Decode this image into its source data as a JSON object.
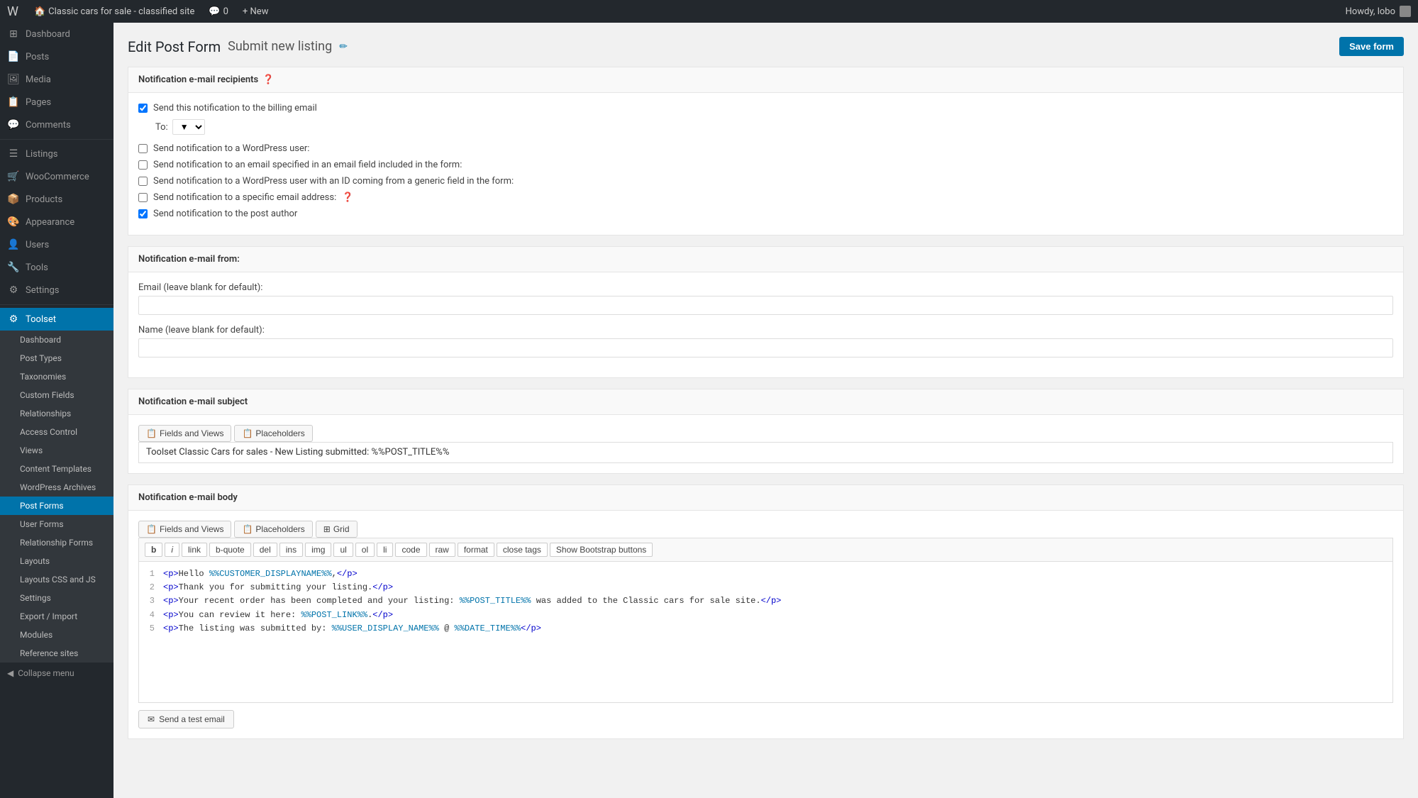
{
  "adminbar": {
    "logo": "W",
    "site_name": "Classic cars for sale - classified site",
    "comments": "0",
    "new_label": "+ New",
    "howdy": "Howdy, lobo",
    "help_icon": "?"
  },
  "sidebar": {
    "menu_items": [
      {
        "id": "dashboard",
        "label": "Dashboard",
        "icon": "⊞"
      },
      {
        "id": "posts",
        "label": "Posts",
        "icon": "📄"
      },
      {
        "id": "media",
        "label": "Media",
        "icon": "🖼"
      },
      {
        "id": "pages",
        "label": "Pages",
        "icon": "📋"
      },
      {
        "id": "comments",
        "label": "Comments",
        "icon": "💬"
      },
      {
        "id": "listings",
        "label": "Listings",
        "icon": "☰"
      },
      {
        "id": "woocommerce",
        "label": "WooCommerce",
        "icon": "🛒"
      },
      {
        "id": "products",
        "label": "Products",
        "icon": "📦"
      },
      {
        "id": "appearance",
        "label": "Appearance",
        "icon": "🎨"
      },
      {
        "id": "users",
        "label": "Users",
        "icon": "👤"
      },
      {
        "id": "tools",
        "label": "Tools",
        "icon": "🔧"
      },
      {
        "id": "settings",
        "label": "Settings",
        "icon": "⚙"
      },
      {
        "id": "toolset",
        "label": "Toolset",
        "icon": "⚙"
      }
    ],
    "submenu_items": [
      {
        "id": "sub-dashboard",
        "label": "Dashboard"
      },
      {
        "id": "sub-post-types",
        "label": "Post Types"
      },
      {
        "id": "sub-taxonomies",
        "label": "Taxonomies"
      },
      {
        "id": "sub-custom-fields",
        "label": "Custom Fields"
      },
      {
        "id": "sub-relationships",
        "label": "Relationships"
      },
      {
        "id": "sub-access-control",
        "label": "Access Control"
      },
      {
        "id": "sub-views",
        "label": "Views"
      },
      {
        "id": "sub-content-templates",
        "label": "Content Templates"
      },
      {
        "id": "sub-wordpress-archives",
        "label": "WordPress Archives"
      },
      {
        "id": "sub-post-forms",
        "label": "Post Forms",
        "active": true
      },
      {
        "id": "sub-user-forms",
        "label": "User Forms"
      },
      {
        "id": "sub-relationship-forms",
        "label": "Relationship Forms"
      },
      {
        "id": "sub-layouts",
        "label": "Layouts"
      },
      {
        "id": "sub-layouts-css",
        "label": "Layouts CSS and JS"
      },
      {
        "id": "sub-settings",
        "label": "Settings"
      },
      {
        "id": "sub-export-import",
        "label": "Export / Import"
      },
      {
        "id": "sub-modules",
        "label": "Modules"
      },
      {
        "id": "sub-reference-sites",
        "label": "Reference sites"
      }
    ],
    "collapse_label": "Collapse menu"
  },
  "page": {
    "edit_label": "Edit Post Form",
    "form_name": "Submit new listing",
    "save_button_label": "Save form"
  },
  "notification_recipients": {
    "section_title": "Notification e-mail recipients",
    "checkboxes": [
      {
        "id": "chk-billing",
        "label": "Send this notification to the billing email",
        "checked": true
      },
      {
        "id": "chk-wp-user",
        "label": "Send notification to a WordPress user:",
        "checked": false
      },
      {
        "id": "chk-email-field",
        "label": "Send notification to an email specified in an email field included in the form:",
        "checked": false
      },
      {
        "id": "chk-wp-id",
        "label": "Send notification to a WordPress user with an ID coming from a generic field in the form:",
        "checked": false
      },
      {
        "id": "chk-specific-email",
        "label": "Send notification to a specific email address:",
        "checked": false,
        "has_help": true
      },
      {
        "id": "chk-post-author",
        "label": "Send notification to the post author",
        "checked": true
      }
    ],
    "to_label": "To:",
    "to_value": "▼"
  },
  "notification_from": {
    "section_title": "Notification e-mail from:",
    "email_label": "Email (leave blank for default):",
    "email_placeholder": "",
    "name_label": "Name (leave blank for default):",
    "name_placeholder": ""
  },
  "notification_subject": {
    "section_title": "Notification e-mail subject",
    "fields_views_label": "Fields and Views",
    "placeholders_label": "Placeholders",
    "subject_value": "Toolset Classic Cars for sales  - New Listing submitted: %%POST_TITLE%%"
  },
  "notification_body": {
    "section_title": "Notification e-mail body",
    "fields_views_label": "Fields and Views",
    "placeholders_label": "Placeholders",
    "grid_label": "Grid",
    "toolbar_buttons": [
      "b",
      "i",
      "link",
      "b-quote",
      "del",
      "ins",
      "img",
      "ul",
      "ol",
      "li",
      "code",
      "raw",
      "format",
      "close tags",
      "Show Bootstrap buttons"
    ],
    "code_lines": [
      {
        "num": 1,
        "content": "<p>Hello %%CUSTOMER_DISPLAYNAME%%,</p>"
      },
      {
        "num": 2,
        "content": "<p>Thank you for submitting your listing.</p>"
      },
      {
        "num": 3,
        "content": "<p>Your recent order has been completed and your listing: %%POST_TITLE%% was added to the Classic cars for sale site.</p>"
      },
      {
        "num": 4,
        "content": "<p>You can review it here: %%POST_LINK%%.</p>"
      },
      {
        "num": 5,
        "content": "<p>The listing was submitted by: %%USER_DISPLAY_NAME%% @ %%DATE_TIME%%</p>"
      }
    ],
    "send_test_label": "Send a test email"
  }
}
